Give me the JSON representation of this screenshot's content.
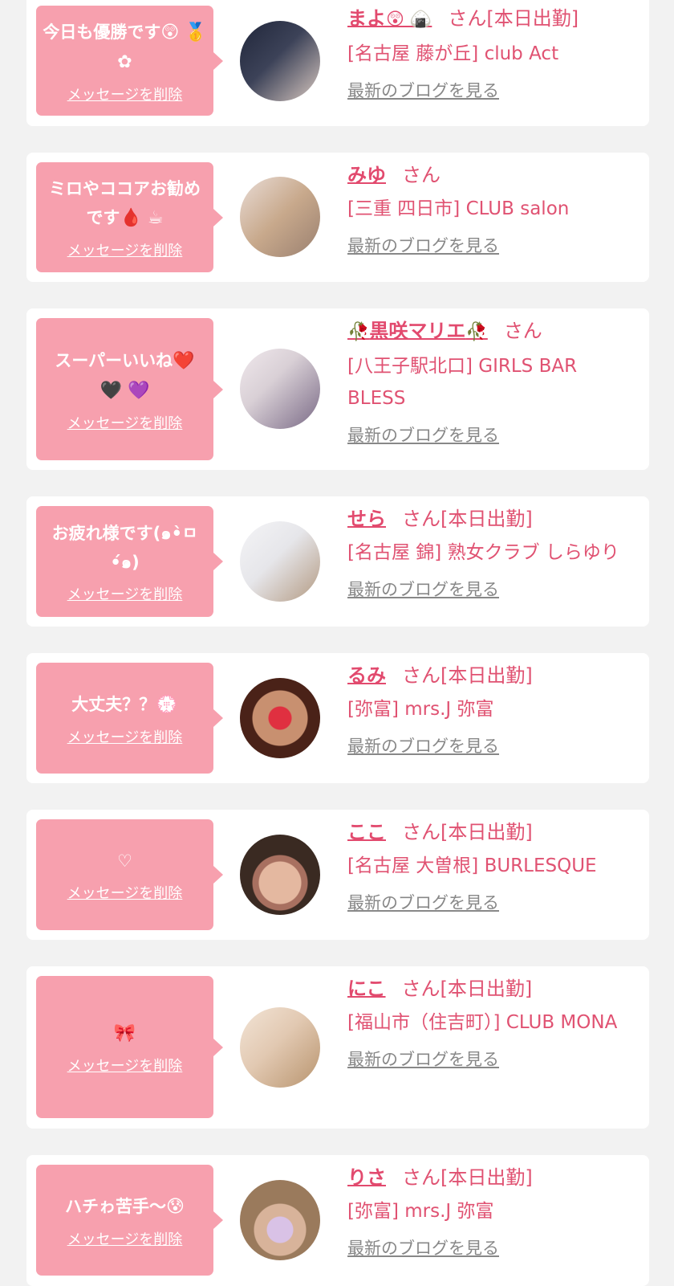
{
  "delete_label": "メッセージを削除",
  "blog_label": "最新のブログを見る",
  "cards": [
    {
      "message": "今日も優勝です",
      "message_emoji": "😲 🥇 ✿",
      "name": "まよ",
      "name_emoji": "😲 🍙",
      "suffix": "さん[本日出勤]",
      "shop": "[名古屋 藤が丘] club Act",
      "avatar_colors": [
        "#20263a",
        "#d8c8c0"
      ]
    },
    {
      "message": "ミロやココアお勧めです",
      "message_emoji": "🩸 ☕",
      "name": "みゆ",
      "name_emoji": "",
      "suffix": "さん",
      "shop": "[三重 四日市] CLUB salon",
      "avatar_colors": [
        "#c8a98c",
        "#e9dcd6"
      ]
    },
    {
      "message": "スーパーいいね",
      "message_emoji": "❤️ 🖤 💜",
      "name": "黒咲マリエ",
      "name_emoji": "🥀",
      "suffix": "さん",
      "shop": "[八王子駅北口] GIRLS BAR BLESS",
      "avatar_colors": [
        "#d9d0d6",
        "#7a6a86"
      ]
    },
    {
      "message": "お疲れ様です(๑•̀ㅁ•́๑)",
      "message_emoji": "",
      "name": "せら",
      "name_emoji": "",
      "suffix": "さん[本日出勤]",
      "shop": "[名古屋 錦] 熟女クラブ しらゆり",
      "avatar_colors": [
        "#e6e6ea",
        "#b39a82"
      ]
    },
    {
      "message": "大丈夫？？",
      "message_emoji": "💮",
      "name": "るみ",
      "name_emoji": "",
      "suffix": "さん[本日出勤]",
      "shop": "[弥富] mrs.J 弥富",
      "avatar_colors": [
        "#4a2218",
        "#c89070"
      ]
    },
    {
      "message": "♡",
      "message_emoji": "",
      "name": "ここ",
      "name_emoji": "",
      "suffix": "さん[本日出勤]",
      "shop": "[名古屋 大曽根] BURLESQUE",
      "avatar_colors": [
        "#3a2a22",
        "#e4b8a0"
      ]
    },
    {
      "message": "🎀",
      "message_emoji": "",
      "name": "にこ",
      "name_emoji": "",
      "suffix": "さん[本日出勤]",
      "shop": "[福山市（住吉町）] CLUB MONA",
      "avatar_colors": [
        "#e2c9b2",
        "#b8946e"
      ]
    },
    {
      "message": "ハチゎ苦手〜",
      "message_emoji": "😰",
      "name": "りさ",
      "name_emoji": "",
      "suffix": "さん[本日出勤]",
      "shop": "[弥富] mrs.J 弥富",
      "avatar_colors": [
        "#9a7a5c",
        "#d9c2e6"
      ]
    }
  ]
}
